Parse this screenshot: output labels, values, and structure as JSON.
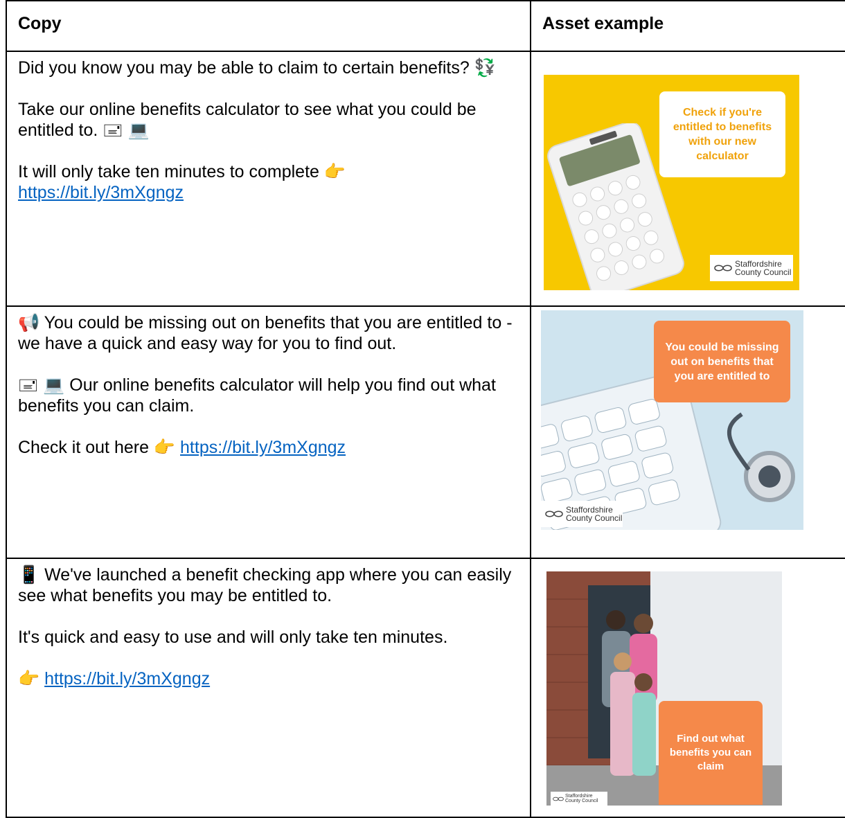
{
  "table": {
    "headers": {
      "copy": "Copy",
      "asset": "Asset example"
    },
    "rows": [
      {
        "paragraphs": [
          "Did you know you may be able to claim to certain benefits? 💱",
          "Take our online benefits calculator to see what you could be entitled to. 🖃 💻",
          "It will only take ten minutes to complete 👉"
        ],
        "link": "https://bit.ly/3mXgngz",
        "asset": {
          "card_text": "Check if you're entitled to benefits with our new calculator",
          "logo_line1": "Staffordshire",
          "logo_line2": "County Council",
          "bg_color": "#f7c800"
        }
      },
      {
        "paragraphs": [
          "📢 You could be missing out on benefits that you are entitled to - we have a quick and easy way for you to find out.",
          "🖃 💻 Our online benefits calculator will help you find out what benefits you can claim."
        ],
        "link_prefix": "Check it out here 👉",
        "link": "https://bit.ly/3mXgngz",
        "asset": {
          "card_text": "You could be missing out on benefits that you are entitled to",
          "logo_line1": "Staffordshire",
          "logo_line2": "County Council",
          "card_color": "#f5894a"
        }
      },
      {
        "paragraphs": [
          "📱 We've launched a benefit checking app where you can easily see what benefits you may be entitled to.",
          "It's quick and easy to use and will only take ten minutes."
        ],
        "link_prefix": "👉",
        "link": "https://bit.ly/3mXgngz",
        "asset": {
          "card_text": "Find out what benefits you can claim",
          "logo_line1": "Staffordshire",
          "logo_line2": "County Council",
          "card_color": "#f5894a"
        }
      }
    ]
  }
}
